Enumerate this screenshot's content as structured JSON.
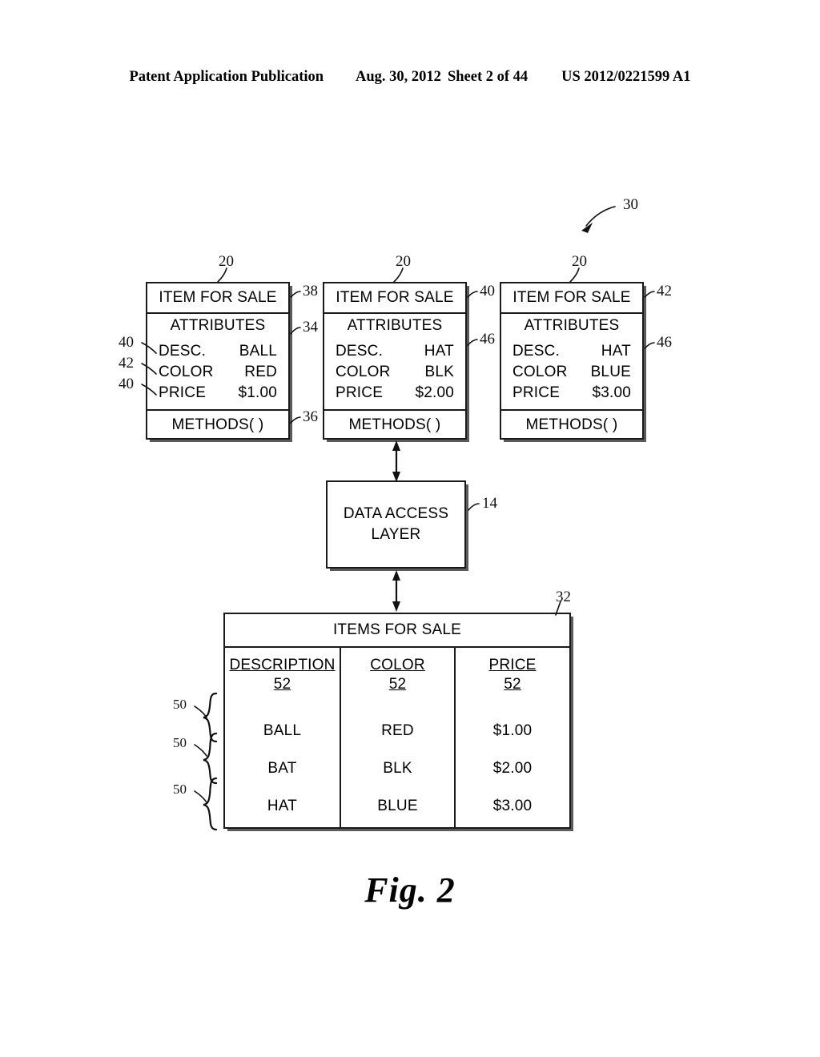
{
  "header": {
    "publication": "Patent Application Publication",
    "date": "Aug. 30, 2012",
    "sheet": "Sheet 2 of 44",
    "patent_number": "US 2012/0221599 A1"
  },
  "figure": {
    "caption": "Fig. 2",
    "overall_ref": "30"
  },
  "objects": [
    {
      "title": "ITEM FOR SALE",
      "attributes_heading": "ATTRIBUTES",
      "methods": "METHODS( )",
      "rows": [
        {
          "name": "DESC.",
          "value": "BALL"
        },
        {
          "name": "COLOR",
          "value": "RED"
        },
        {
          "name": "PRICE",
          "value": "$1.00"
        }
      ],
      "ref_top": "20",
      "ref_title": "38",
      "ref_attrs": "34",
      "ref_methods": "36",
      "left_refs": [
        "40",
        "42",
        "40"
      ]
    },
    {
      "title": "ITEM FOR SALE",
      "attributes_heading": "ATTRIBUTES",
      "methods": "METHODS( )",
      "rows": [
        {
          "name": "DESC.",
          "value": "HAT"
        },
        {
          "name": "COLOR",
          "value": "BLK"
        },
        {
          "name": "PRICE",
          "value": "$2.00"
        }
      ],
      "ref_top": "20",
      "ref_title": "40",
      "ref_attrs": "46"
    },
    {
      "title": "ITEM FOR SALE",
      "attributes_heading": "ATTRIBUTES",
      "methods": "METHODS( )",
      "rows": [
        {
          "name": "DESC.",
          "value": "HAT"
        },
        {
          "name": "COLOR",
          "value": "BLUE"
        },
        {
          "name": "PRICE",
          "value": "$3.00"
        }
      ],
      "ref_top": "20",
      "ref_title": "42",
      "ref_attrs": "46"
    }
  ],
  "data_access_layer": {
    "line1": "DATA ACCESS",
    "line2": "LAYER",
    "ref": "14"
  },
  "database": {
    "title": "ITEMS FOR SALE",
    "ref": "32",
    "columns": [
      {
        "name": "DESCRIPTION",
        "ref": "52"
      },
      {
        "name": "COLOR",
        "ref": "52"
      },
      {
        "name": "PRICE",
        "ref": "52"
      }
    ],
    "rows": [
      {
        "ref": "50",
        "description": "BALL",
        "color": "RED",
        "price": "$1.00"
      },
      {
        "ref": "50",
        "description": "BAT",
        "color": "BLK",
        "price": "$2.00"
      },
      {
        "ref": "50",
        "description": "HAT",
        "color": "BLUE",
        "price": "$3.00"
      }
    ]
  }
}
